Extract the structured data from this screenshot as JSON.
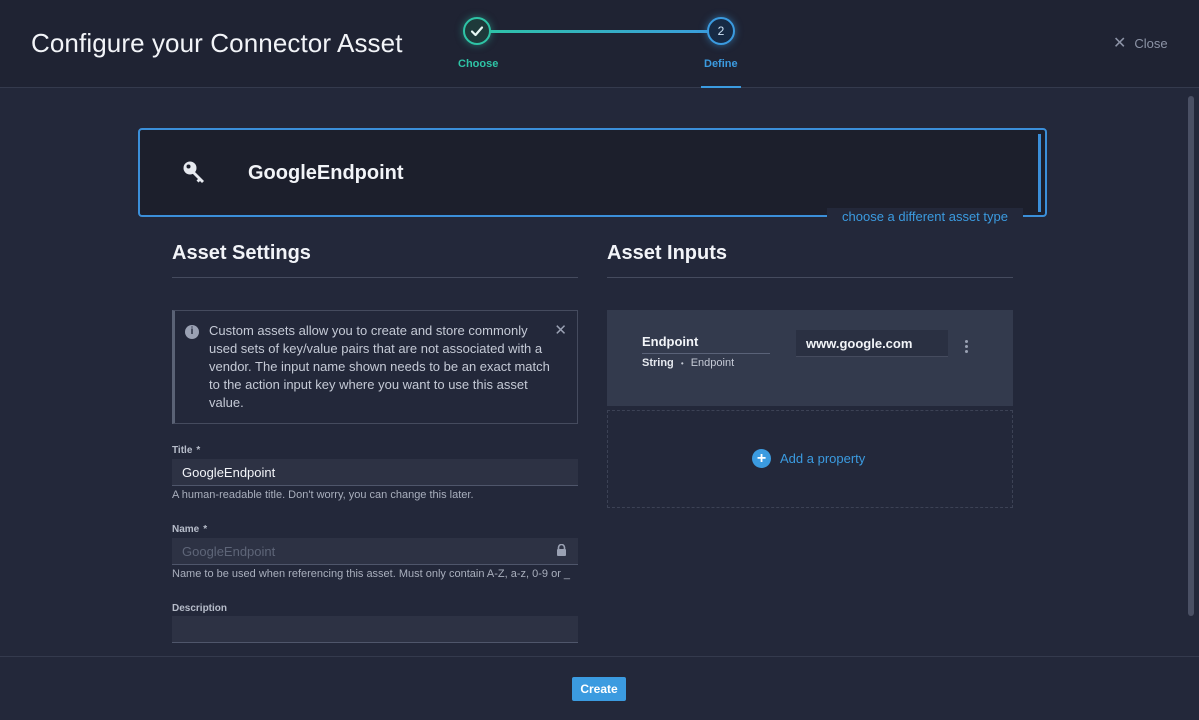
{
  "header": {
    "title": "Configure your Connector Asset",
    "close_label": "Close",
    "steps": [
      {
        "label": "Choose",
        "status": "complete"
      },
      {
        "label": "Define",
        "number": "2",
        "status": "active"
      }
    ]
  },
  "asset_type": {
    "name": "GoogleEndpoint",
    "icon": "key-icon",
    "change_link": "choose a different asset type"
  },
  "settings": {
    "title": "Asset Settings",
    "info": "Custom assets allow you to create and store commonly used sets of key/value pairs that are not associated with a vendor. The input name shown needs to be an exact match to the action input key where you want to use this asset value.",
    "fields": {
      "title": {
        "label": "Title",
        "required": "*",
        "value": "GoogleEndpoint",
        "help": "A human-readable title. Don't worry, you can change this later."
      },
      "name": {
        "label": "Name",
        "required": "*",
        "value": "GoogleEndpoint",
        "help": "Name to be used when referencing this asset. Must only contain A-Z, a-z, 0-9 or _"
      },
      "description": {
        "label": "Description",
        "value": ""
      }
    }
  },
  "inputs": {
    "title": "Asset Inputs",
    "properties": [
      {
        "name": "Endpoint",
        "type": "String",
        "separator": "•",
        "key": "Endpoint",
        "value": "www.google.com"
      }
    ],
    "add_label": "Add a property"
  },
  "footer": {
    "create_label": "Create"
  },
  "colors": {
    "accent": "#3b9be0",
    "success": "#2ec4a6",
    "background": "#23283a"
  }
}
